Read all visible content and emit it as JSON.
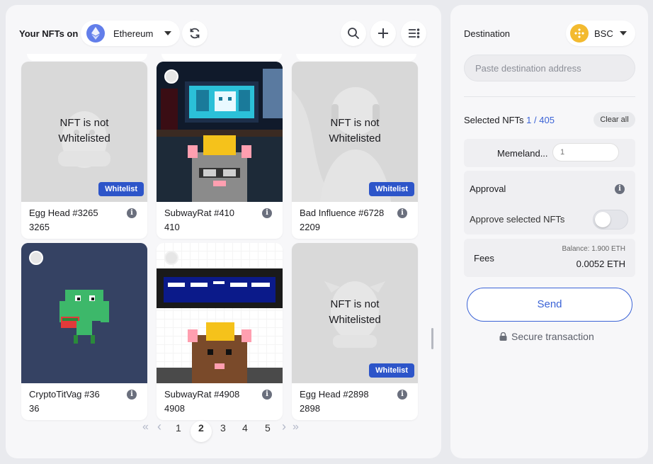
{
  "header": {
    "title": "Your NFTs on",
    "chain": "Ethereum"
  },
  "cards": [
    {
      "name": "Egg Head #3265",
      "number": "3265",
      "overlay_line1": "NFT is not",
      "overlay_line2": "Whitelisted",
      "badge": "Whitelist"
    },
    {
      "name": "SubwayRat #410",
      "number": "410"
    },
    {
      "name": "Bad Influence #6728",
      "number": "2209",
      "overlay_line1": "NFT is not",
      "overlay_line2": "Whitelisted",
      "badge": "Whitelist"
    },
    {
      "name": "CryptoTitVag #36",
      "number": "36"
    },
    {
      "name": "SubwayRat #4908",
      "number": "4908"
    },
    {
      "name": "Egg Head #2898",
      "number": "2898",
      "overlay_line1": "NFT is not",
      "overlay_line2": "Whitelisted",
      "badge": "Whitelist"
    }
  ],
  "pagination": {
    "first": "«",
    "prev": "‹",
    "pages": [
      "1",
      "2",
      "3",
      "4",
      "5"
    ],
    "current": "2",
    "next": "›",
    "last": "»"
  },
  "right": {
    "destination_label": "Destination",
    "dest_chain": "BSC",
    "address_placeholder": "Paste destination address",
    "selected_label": "Selected NFTs",
    "selected_count": "1 / 405",
    "clear_all": "Clear all",
    "collection_name": "Memeland...",
    "collection_qty_placeholder": "1",
    "approval_title": "Approval",
    "approve_label": "Approve selected NFTs",
    "approve_on": false,
    "fees_label": "Fees",
    "balance": "Balance: 1.900 ETH",
    "fee_amount": "0.0052 ETH",
    "send_label": "Send",
    "secure_label": "Secure transaction"
  },
  "colors": {
    "accent": "#3b63d6",
    "whitelist_badge": "#2d55c9",
    "eth": "#627eea",
    "bnb": "#f3ba2f"
  }
}
